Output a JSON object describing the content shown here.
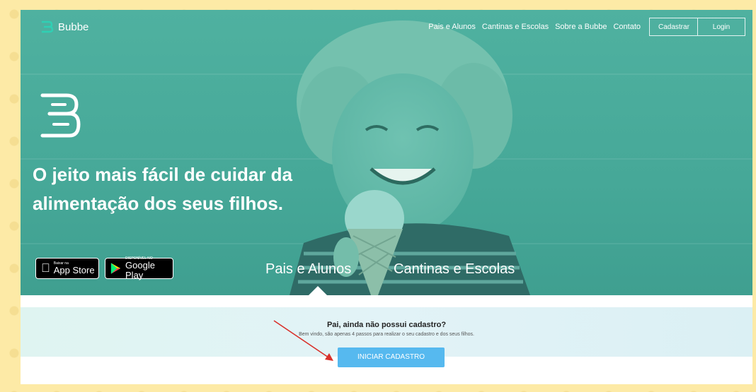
{
  "brand": {
    "name": "Bubbe"
  },
  "nav": {
    "links": [
      "Pais e Alunos",
      "Cantinas e Escolas",
      "Sobre a Bubbe",
      "Contato"
    ],
    "register_label": "Cadastrar",
    "login_label": "Login"
  },
  "hero": {
    "headline_line1": "O jeito mais fácil de cuidar da",
    "headline_line2": "alimentação dos seus filhos.",
    "app_store": {
      "small": "Baixar na",
      "big": "App Store"
    },
    "google_play": {
      "small": "DISPONÍVEL NO",
      "big": "Google Play"
    },
    "tabs": [
      "Pais e Alunos",
      "Cantinas e Escolas"
    ],
    "active_tab": "Pais e Alunos"
  },
  "signup": {
    "question": "Pai, ainda não possui cadastro?",
    "subtitle": "Bem vindo, são apenas 4 passos para realizar o seu cadastro e dos seus filhos.",
    "cta_label": "INICIAR CADASTRO"
  },
  "colors": {
    "hero_overlay": "#47a998",
    "cta": "#56b9ef",
    "annotation_arrow": "#d9302a"
  }
}
